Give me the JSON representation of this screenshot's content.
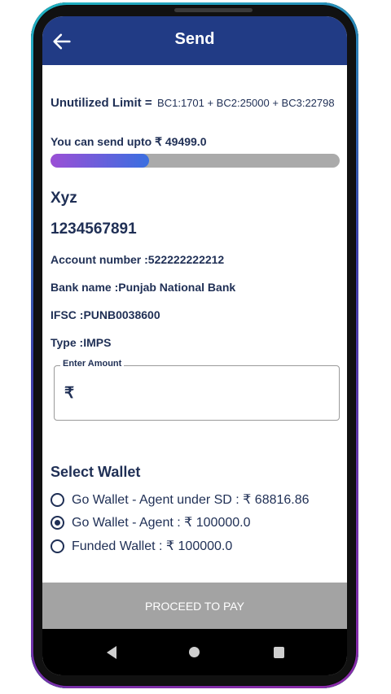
{
  "appbar": {
    "title": "Send",
    "back_icon": "arrow-left-icon"
  },
  "limit": {
    "label": "Unutilized Limit =",
    "value": "BC1:1701 + BC2:25000 + BC3:22798"
  },
  "send_upto": {
    "text": "You can send upto ₹ 49499.0",
    "progress_fraction": 0.34
  },
  "beneficiary": {
    "name": "Xyz",
    "phone": "1234567891",
    "account": "Account number :522222222212",
    "bank": "Bank name :Punjab National Bank",
    "ifsc": "IFSC :PUNB0038600",
    "type": "Type :IMPS"
  },
  "amount_field": {
    "label": "Enter Amount",
    "currency_symbol": "₹",
    "value": ""
  },
  "wallet": {
    "heading": "Select Wallet",
    "options": [
      {
        "label": "Go Wallet - Agent under SD :  ₹ 68816.86",
        "selected": false
      },
      {
        "label": "Go Wallet - Agent :  ₹ 100000.0",
        "selected": true
      },
      {
        "label": "Funded Wallet :  ₹ 100000.0",
        "selected": false
      }
    ]
  },
  "proceed_button": {
    "label": "PROCEED TO PAY"
  },
  "colors": {
    "appbar": "#213b85",
    "text": "#1f2f55",
    "progress_start": "#9b4fd6",
    "progress_end": "#3a6fe0",
    "button_disabled": "#a3a3a3"
  }
}
